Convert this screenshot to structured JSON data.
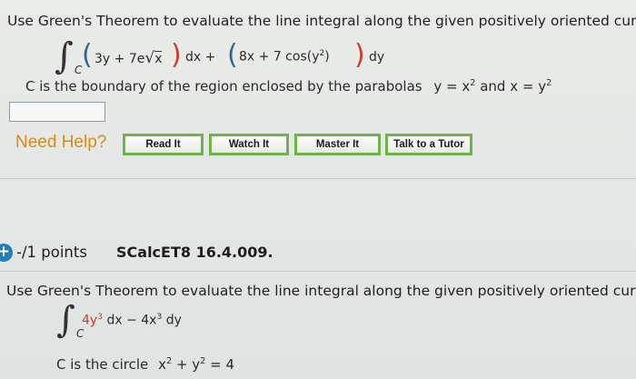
{
  "question1": {
    "prompt": "Use Green's Theorem to evaluate the line integral along the given positively oriented curve.",
    "integral_sub": "C",
    "term1_left": "3y + 7e",
    "term1_radical": "√",
    "term1_radicand": "x",
    "dx": "dx +",
    "term2_left": "8x + 7 cos(y",
    "term2_exp": "2",
    "term2_right": ")",
    "dy": "dy",
    "desc_text": "C is the boundary of the region enclosed by the parabolas",
    "desc_eq1_base": "y = x",
    "desc_eq1_exp": "2",
    "desc_and": "and",
    "desc_eq2_base": "x = y",
    "desc_eq2_exp": "2",
    "answer_value": ""
  },
  "help": {
    "label": "Need Help?",
    "buttons": [
      "Read It",
      "Watch It",
      "Master It",
      "Talk to a Tutor"
    ]
  },
  "question2": {
    "icon": "+",
    "points": "-/1 points",
    "code": "SCalcET8 16.4.009.",
    "prompt": "Use Green's Theorem to evaluate the line integral along the given positively oriented curve.",
    "integral_sub": "C",
    "term1": "4y",
    "term1_exp": "3",
    "dx_minus": "dx − 4x",
    "term2_exp": "3",
    "dy": "dy",
    "desc_text": "C is the circle",
    "desc_eq_a": "x",
    "desc_eq_a_exp": "2",
    "desc_eq_plus": "+ y",
    "desc_eq_b_exp": "2",
    "desc_eq_rhs": "= 4"
  },
  "colors": {
    "accent_green": "#6fb24c",
    "need_help_orange": "#d98a1d",
    "points_blue": "#1f7fb8",
    "math_red": "#d23a2a"
  }
}
